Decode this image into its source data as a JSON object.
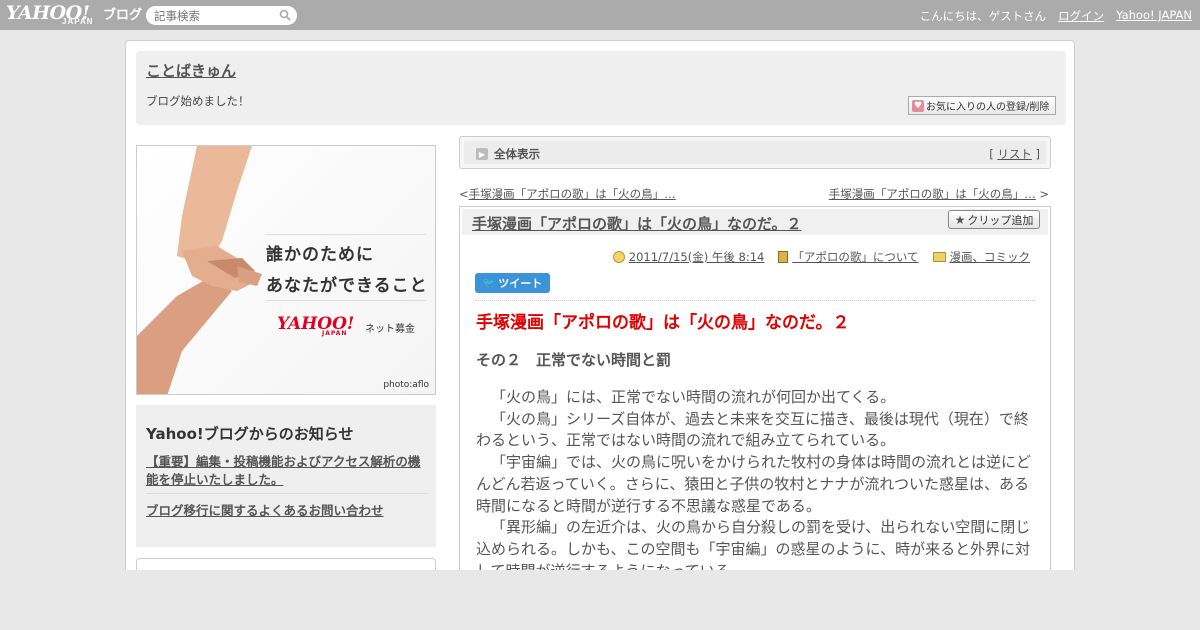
{
  "topbar": {
    "logo": "YAHOO!",
    "logo_sub": "JAPAN",
    "blog_label": "ブログ",
    "search_placeholder": "記事検索",
    "greeting": "こんにちは、ゲストさん",
    "login": "ログイン",
    "yahoo_japan": "Yahoo! JAPAN"
  },
  "header": {
    "title": "ことばきゅん",
    "description": "ブログ始めました！",
    "fav_button": "お気に入りの人の登録/削除"
  },
  "banner": {
    "line1": "誰かのために",
    "line2": "あなたができること",
    "logo": "YAHOO!",
    "logo_sub": "JAPAN",
    "logo_text": "ネット募金",
    "credit": "photo:aflo"
  },
  "notice": {
    "title": "Yahoo!ブログからのお知らせ",
    "link1": "【重要】編集・投稿機能およびアクセス解析の機能を停止いたしました。",
    "link2": "ブログ移行に関するよくあるお問い合わせ"
  },
  "view_bar": {
    "label": "全体表示",
    "list_open": "[ ",
    "list_link": "リスト",
    "list_close": " ]"
  },
  "nav": {
    "prev_prefix": "<",
    "prev": "手塚漫画「アポロの歌」は「火の鳥」…",
    "next": "手塚漫画「アポロの歌」は「火の鳥」…",
    "next_suffix": " >"
  },
  "article": {
    "title": "手塚漫画「アポロの歌」は「火の鳥」なのだ。２",
    "clip_button": "クリップ追加",
    "date": "2011/7/15(金) 午後 8:14",
    "category": "「アポロの歌」について",
    "genre": "漫画、コミック",
    "tweet": "ツイート",
    "body_title": "手塚漫画「アポロの歌」は「火の鳥」なのだ。２",
    "body_sub": "その２　正常でない時間と罰",
    "paragraphs": [
      "「火の鳥」には、正常でない時間の流れが何回か出てくる。",
      "「火の鳥」シリーズ自体が、過去と未来を交互に描き、最後は現代（現在）で終わるという、正常ではない時間の流れで組み立てられている。",
      "「宇宙編」では、火の鳥に呪いをかけられた牧村の身体は時間の流れとは逆にどんどん若返っていく。さらに、猿田と子供の牧村とナナが流れついた惑星は、ある時間になると時間が逆行する不思議な惑星である。",
      "「異形編」の左近介は、火の鳥から自分殺しの罰を受け、出られない空間に閉じ込められる。しかも、この空間も「宇宙編」の惑星のように、時が来ると外界に対して時間が逆行するようになっている。"
    ]
  }
}
